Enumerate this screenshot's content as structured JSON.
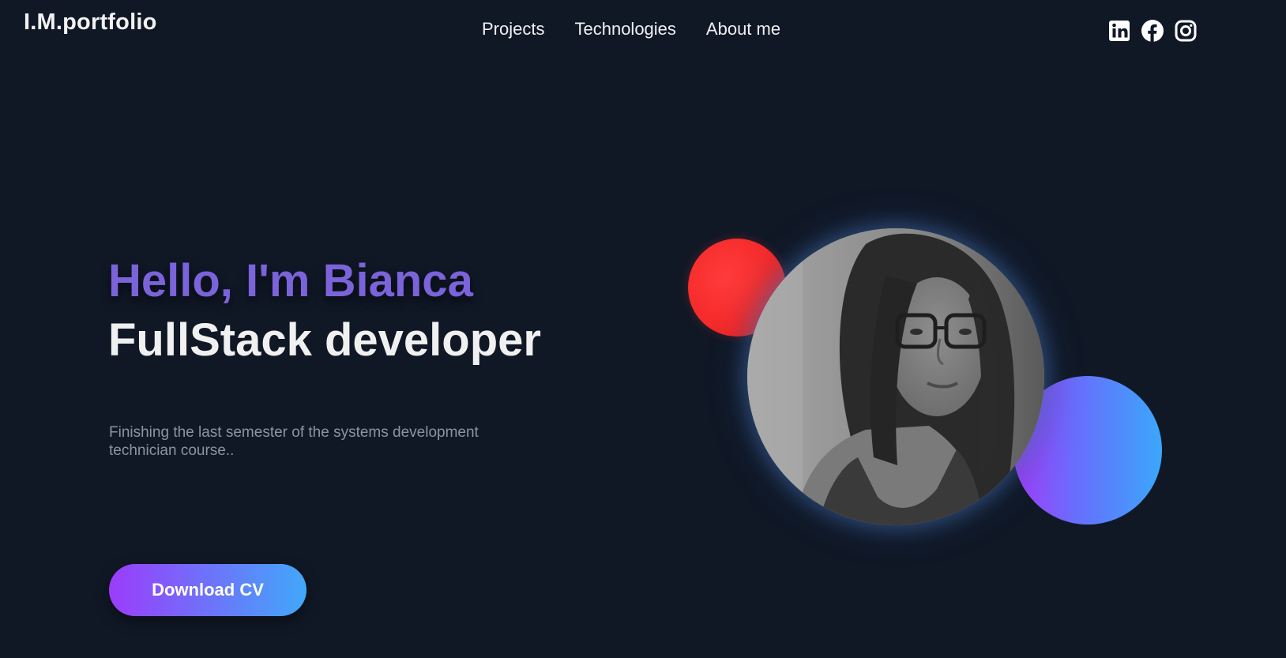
{
  "header": {
    "logo": "I.M.portfolio",
    "nav": [
      {
        "label": "Projects"
      },
      {
        "label": "Technologies"
      },
      {
        "label": "About me"
      }
    ],
    "socials": [
      {
        "icon": "linkedin-icon"
      },
      {
        "icon": "facebook-icon"
      },
      {
        "icon": "instagram-icon"
      }
    ]
  },
  "hero": {
    "greeting": "Hello, I'm Bianca",
    "role": "FullStack developer",
    "description": "Finishing the last semester of the systems development technician course..",
    "cta_label": "Download CV"
  },
  "colors": {
    "background": "#101826",
    "greeting": "#7b63d9",
    "accent_red": "#f52a2a",
    "gradient_start": "#9b3cfb",
    "gradient_end": "#41a8fa",
    "muted_text": "#8d93a3"
  }
}
